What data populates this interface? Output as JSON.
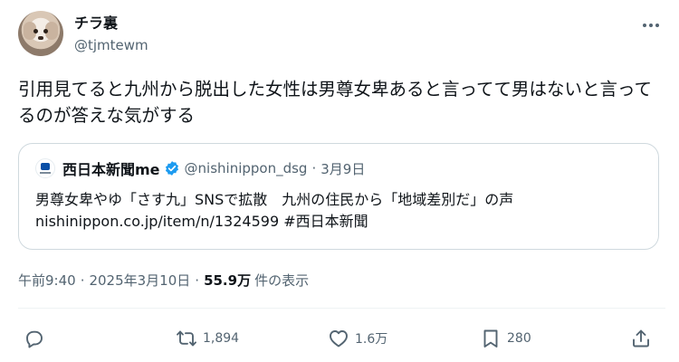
{
  "tweet": {
    "author": {
      "display_name": "チラ裏",
      "handle": "@tjmtewm"
    },
    "text": "引用見てると九州から脱出した女性は男尊女卑あると言ってて男はないと言ってるのが答えな気がする",
    "quote": {
      "display_name": "西日本新聞me",
      "handle": "@nishinippon_dsg",
      "dot": "·",
      "date": "3月9日",
      "line1": "男尊女卑やゆ「さす九」SNSで拡散　九州の住民から「地域差別だ」の声",
      "line2": "nishinippon.co.jp/item/n/1324599 #西日本新聞"
    },
    "meta": {
      "time": "午前9:40",
      "sep1": "·",
      "date": "2025年3月10日",
      "sep2": "·",
      "views_count": "55.9万",
      "views_label": "件の表示"
    },
    "actions": {
      "reply_count": "",
      "retweet_count": "1,894",
      "like_count": "1.6万",
      "bookmark_count": "280"
    }
  },
  "colors": {
    "text": "#0f1419",
    "secondary": "#536471",
    "border": "#cfd9de",
    "verified": "#1d9bf0"
  },
  "icons": [
    "more-icon",
    "verified-badge-icon",
    "reply-icon",
    "retweet-icon",
    "like-icon",
    "bookmark-icon",
    "share-icon"
  ]
}
